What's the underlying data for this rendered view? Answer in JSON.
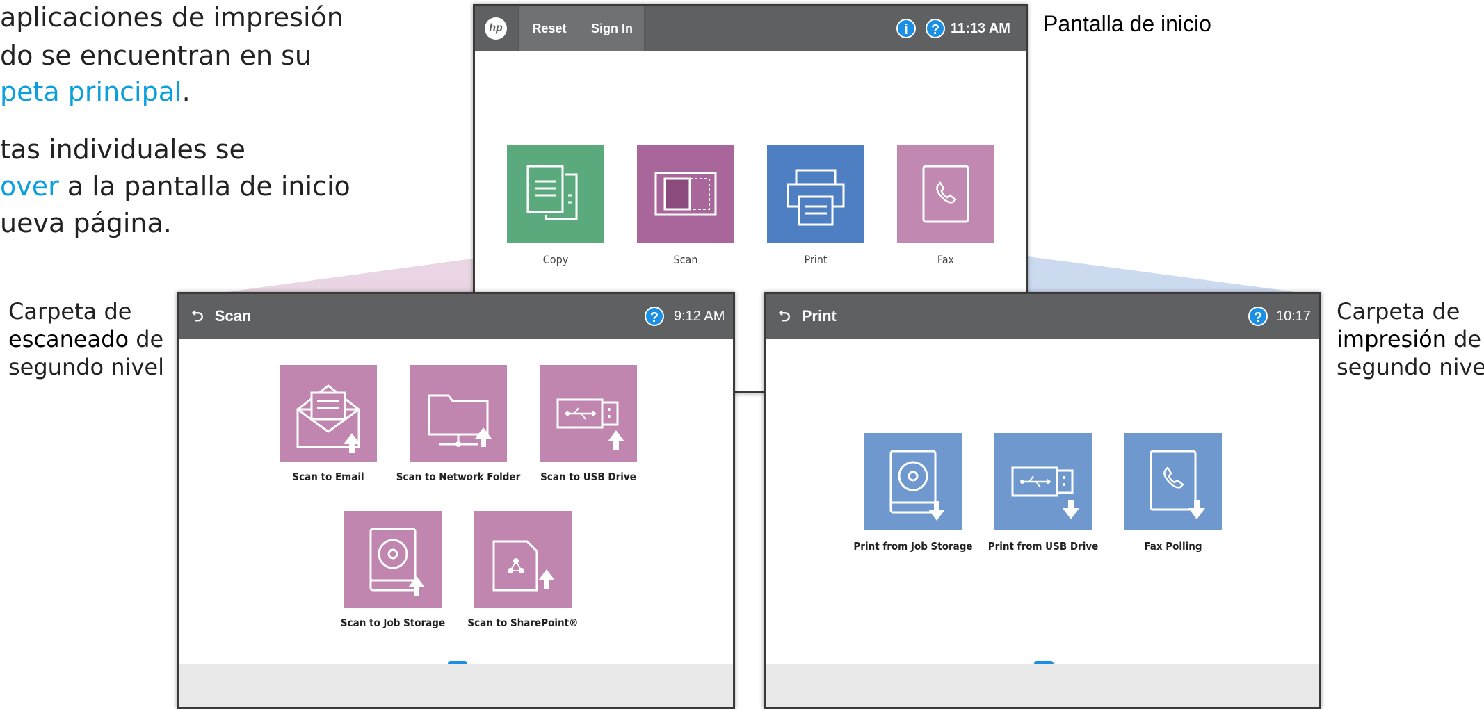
{
  "intro": {
    "line1": "aplicaciones de impresión",
    "line2": "do se encuentran en su",
    "line3_highlight": "peta principal",
    "line3_tail": ".",
    "line4": "tas individuales se",
    "line5_highlight": "over",
    "line5_tail": " a la pantalla de inicio",
    "line6": "ueva página."
  },
  "home_caption": "Pantalla de inicio",
  "scan_caption": {
    "line1": "Carpeta de",
    "bold": "escaneado",
    "tail": " de",
    "line3": "segundo nivel"
  },
  "print_caption": {
    "line1": "Carpeta de",
    "bold": "impresión",
    "tail": " de",
    "line3": "segundo nivel"
  },
  "home_screen": {
    "logo": "hp",
    "reset_label": "Reset",
    "signin_label": "Sign In",
    "info_icon": "i",
    "help_icon": "?",
    "time": "11:13 AM",
    "apps": [
      {
        "label": "Copy",
        "color": "#5aaa7e"
      },
      {
        "label": "Scan",
        "color": "#a9669a"
      },
      {
        "label": "Print",
        "color": "#4d7fc2"
      },
      {
        "label": "Fax",
        "color": "#c188b2"
      }
    ]
  },
  "scan_screen": {
    "back_icon": "⮌",
    "title": "Scan",
    "help_icon": "?",
    "time": "9:12 AM",
    "tile_color": "#c086b0",
    "items": [
      {
        "label": "Scan to Email",
        "icon": "email-upload-icon"
      },
      {
        "label": "Scan to Network Folder",
        "icon": "network-folder-upload-icon"
      },
      {
        "label": "Scan to USB Drive",
        "icon": "usb-upload-icon"
      },
      {
        "label": "Scan to Job Storage",
        "icon": "storage-upload-icon"
      },
      {
        "label": "Scan to SharePoint®",
        "icon": "sharepoint-upload-icon"
      }
    ]
  },
  "print_screen": {
    "back_icon": "⮌",
    "title": "Print",
    "help_icon": "?",
    "time": "10:17",
    "tile_color": "#6f98cf",
    "items": [
      {
        "label": "Print from Job Storage",
        "icon": "storage-download-icon"
      },
      {
        "label": "Print from USB Drive",
        "icon": "usb-download-icon"
      },
      {
        "label": "Fax Polling",
        "icon": "fax-download-icon"
      }
    ]
  }
}
